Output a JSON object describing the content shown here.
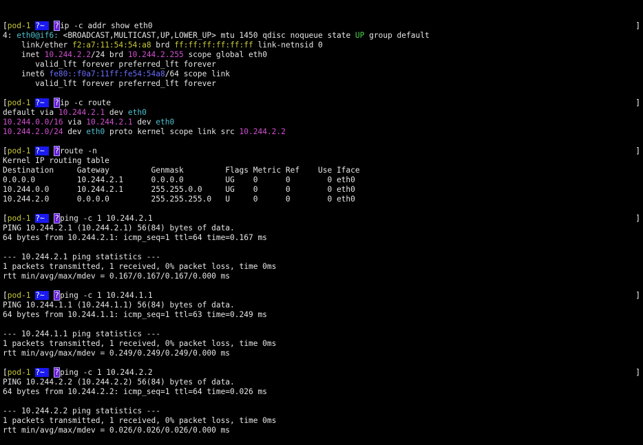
{
  "terminal": {
    "prompt": {
      "user": "pod-1",
      "dir": "~",
      "glyph": "?"
    },
    "blocks": [
      {
        "command": "ip -c addr show eth0",
        "lines": [
          [
            {
              "t": "4: "
            },
            {
              "t": "eth0@if6:",
              "c": "if"
            },
            {
              "t": " <BROADCAST,MULTICAST,UP,LOWER_UP> mtu 1450 qdisc noqueue state "
            },
            {
              "t": "UP",
              "c": "up"
            },
            {
              "t": " group default"
            }
          ],
          [
            {
              "t": "    link/ether "
            },
            {
              "t": "f2:a7:11:54:54:a8",
              "c": "mac"
            },
            {
              "t": " brd "
            },
            {
              "t": "ff:ff:ff:ff:ff:ff",
              "c": "mac"
            },
            {
              "t": " link-netnsid 0"
            }
          ],
          [
            {
              "t": "    inet "
            },
            {
              "t": "10.244.2.2",
              "c": "ip"
            },
            {
              "t": "/24 brd "
            },
            {
              "t": "10.244.2.255",
              "c": "ip"
            },
            {
              "t": " scope global eth0"
            }
          ],
          [
            {
              "t": "       valid_lft forever preferred_lft forever"
            }
          ],
          [
            {
              "t": "    inet6 "
            },
            {
              "t": "fe80::f0a7:11ff:fe54:54a8",
              "c": "ip6"
            },
            {
              "t": "/64 scope link"
            }
          ],
          [
            {
              "t": "       valid_lft forever preferred_lft forever"
            }
          ],
          [
            {
              "t": ""
            }
          ]
        ]
      },
      {
        "command": "ip -c route",
        "lines": [
          [
            {
              "t": "default via "
            },
            {
              "t": "10.244.2.1",
              "c": "ip"
            },
            {
              "t": " dev "
            },
            {
              "t": "eth0",
              "c": "if"
            }
          ],
          [
            {
              "t": "10.244.0.0/16",
              "c": "ip"
            },
            {
              "t": " via "
            },
            {
              "t": "10.244.2.1",
              "c": "ip"
            },
            {
              "t": " dev "
            },
            {
              "t": "eth0",
              "c": "if"
            }
          ],
          [
            {
              "t": "10.244.2.0/24",
              "c": "ip"
            },
            {
              "t": " dev "
            },
            {
              "t": "eth0",
              "c": "if"
            },
            {
              "t": " proto kernel scope link src "
            },
            {
              "t": "10.244.2.2",
              "c": "ip"
            }
          ],
          [
            {
              "t": ""
            }
          ]
        ]
      },
      {
        "command": "route -n",
        "lines": [
          [
            {
              "t": "Kernel IP routing table"
            }
          ],
          [
            {
              "t": "Destination     Gateway         Genmask         Flags Metric Ref    Use Iface"
            }
          ],
          [
            {
              "t": "0.0.0.0         10.244.2.1      0.0.0.0         UG    0      0        0 eth0"
            }
          ],
          [
            {
              "t": "10.244.0.0      10.244.2.1      255.255.0.0     UG    0      0        0 eth0"
            }
          ],
          [
            {
              "t": "10.244.2.0      0.0.0.0         255.255.255.0   U     0      0        0 eth0"
            }
          ],
          [
            {
              "t": ""
            }
          ]
        ]
      },
      {
        "command": "ping -c 1 10.244.2.1",
        "lines": [
          [
            {
              "t": "PING 10.244.2.1 (10.244.2.1) 56(84) bytes of data."
            }
          ],
          [
            {
              "t": "64 bytes from 10.244.2.1: icmp_seq=1 ttl=64 time=0.167 ms"
            }
          ],
          [
            {
              "t": ""
            }
          ],
          [
            {
              "t": "--- 10.244.2.1 ping statistics ---"
            }
          ],
          [
            {
              "t": "1 packets transmitted, 1 received, 0% packet loss, time 0ms"
            }
          ],
          [
            {
              "t": "rtt min/avg/max/mdev = 0.167/0.167/0.167/0.000 ms"
            }
          ],
          [
            {
              "t": ""
            }
          ]
        ]
      },
      {
        "command": "ping -c 1 10.244.1.1",
        "lines": [
          [
            {
              "t": "PING 10.244.1.1 (10.244.1.1) 56(84) bytes of data."
            }
          ],
          [
            {
              "t": "64 bytes from 10.244.1.1: icmp_seq=1 ttl=63 time=0.249 ms"
            }
          ],
          [
            {
              "t": ""
            }
          ],
          [
            {
              "t": "--- 10.244.1.1 ping statistics ---"
            }
          ],
          [
            {
              "t": "1 packets transmitted, 1 received, 0% packet loss, time 0ms"
            }
          ],
          [
            {
              "t": "rtt min/avg/max/mdev = 0.249/0.249/0.249/0.000 ms"
            }
          ],
          [
            {
              "t": ""
            }
          ]
        ]
      },
      {
        "command": "ping -c 1 10.244.2.2",
        "lines": [
          [
            {
              "t": "PING 10.244.2.2 (10.244.2.2) 56(84) bytes of data."
            }
          ],
          [
            {
              "t": "64 bytes from 10.244.2.2: icmp_seq=1 ttl=64 time=0.026 ms"
            }
          ],
          [
            {
              "t": ""
            }
          ],
          [
            {
              "t": "--- 10.244.2.2 ping statistics ---"
            }
          ],
          [
            {
              "t": "1 packets transmitted, 1 received, 0% packet loss, time 0ms"
            }
          ],
          [
            {
              "t": "rtt min/avg/max/mdev = 0.026/0.026/0.026/0.000 ms"
            }
          ]
        ]
      }
    ]
  },
  "colors": {
    "background": "#000000",
    "foreground": "#e6e6e6",
    "ip": "#d14fd1",
    "interface": "#4fc0d0",
    "mac": "#c9c93a",
    "ipv6": "#6b6bff",
    "state_up": "#4fd04f",
    "prompt_dir_bg": "#1a1af0",
    "prompt_glyph_bg": "#6a1ad8"
  }
}
